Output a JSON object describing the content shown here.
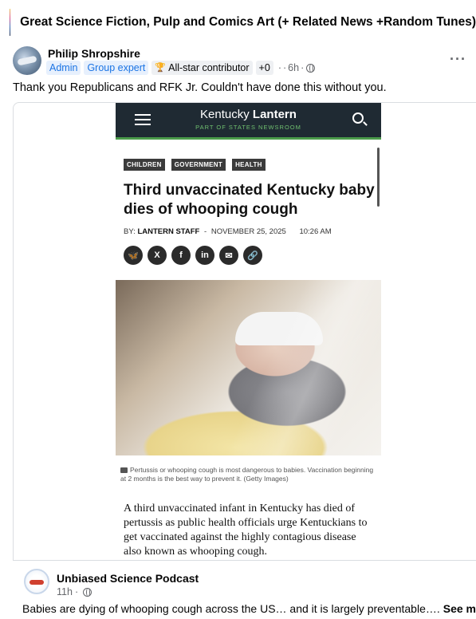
{
  "group": {
    "name": "Great Science Fiction, Pulp and Comics Art (+ Related News +Random Tunes)"
  },
  "post": {
    "author": "Philip Shropshire",
    "badges": [
      "Admin",
      "Group expert"
    ],
    "contributor_badge": "All-star contributor",
    "plus_badge": "+0",
    "separator": "·",
    "time": "6h",
    "menu": "···",
    "text": "Thank you Republicans and RFK Jr. Couldn't have done this without you."
  },
  "article": {
    "site_name_light": "Kentucky",
    "site_name_bold": "Lantern",
    "site_subtitle": "PART OF STATES NEWSROOM",
    "tags": [
      "CHILDREN",
      "GOVERNMENT",
      "HEALTH"
    ],
    "headline": "Third unvaccinated Kentucky baby dies of whooping cough",
    "byline_prefix": "BY:",
    "byline_author": "LANTERN STAFF",
    "byline_dash": "-",
    "date": "NOVEMBER 25, 2025",
    "time": "10:26 AM",
    "share_icons": [
      {
        "name": "bluesky-icon",
        "glyph": "🦋"
      },
      {
        "name": "x-icon",
        "glyph": "X"
      },
      {
        "name": "facebook-icon",
        "glyph": "f"
      },
      {
        "name": "linkedin-icon",
        "glyph": "in"
      },
      {
        "name": "email-icon",
        "glyph": "✉"
      },
      {
        "name": "link-icon",
        "glyph": "🔗"
      }
    ],
    "caption": "Pertussis or whooping cough is most dangerous to babies. Vaccination beginning at 2 months is the best way to prevent it. (Getty Images)",
    "body": "A third unvaccinated infant in Kentucky has died of pertussis as public health officials urge Kentuckians to get vaccinated against the highly contagious disease also known as whooping cough."
  },
  "shared": {
    "name": "Unbiased Science Podcast",
    "time": "11h",
    "separator": "·",
    "text": "Babies are dying of whooping cough across the US… and it is largely preventable….",
    "see_more": "See more"
  },
  "colors": {
    "nav_bg": "#1f2a33",
    "nav_accent": "#4a9a4a",
    "badge_blue": "#1b74e4",
    "meta_gray": "#65676b"
  }
}
